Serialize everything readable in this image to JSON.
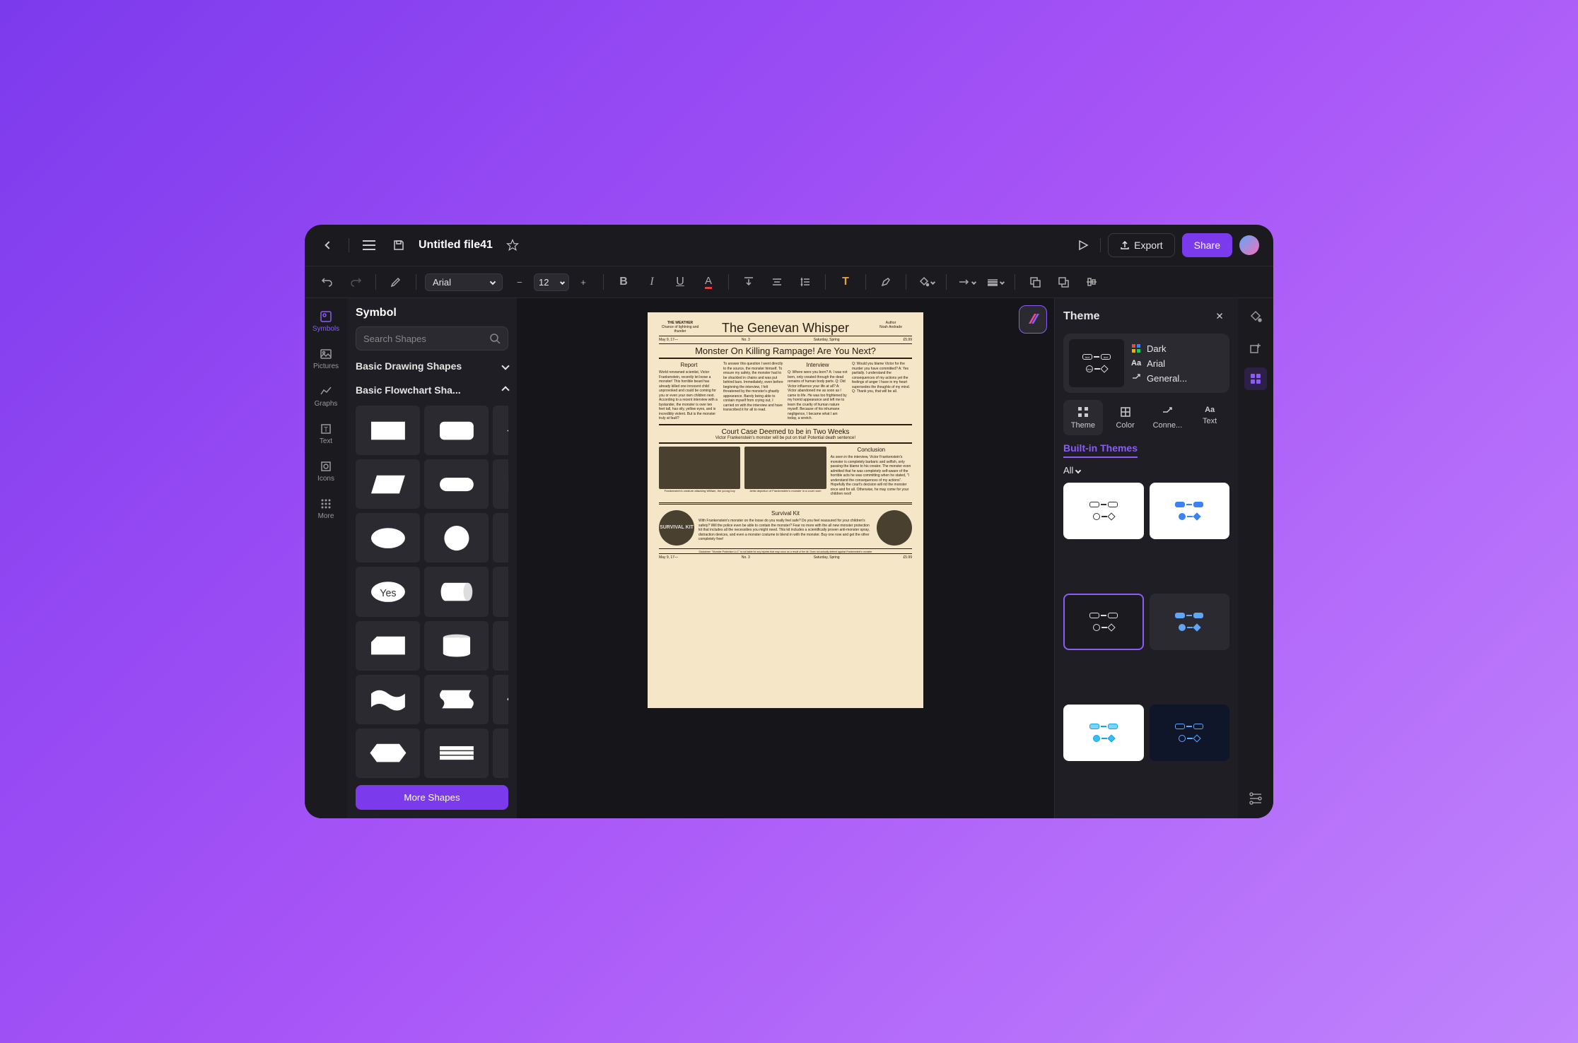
{
  "titlebar": {
    "filename": "Untitled file41",
    "export_label": "Export",
    "share_label": "Share"
  },
  "format_bar": {
    "font": "Arial",
    "size": "12"
  },
  "left_rail": {
    "symbols": "Symbols",
    "pictures": "Pictures",
    "graphs": "Graphs",
    "text": "Text",
    "icons": "Icons",
    "more": "More"
  },
  "left_panel": {
    "title": "Symbol",
    "search_placeholder": "Search Shapes",
    "categories": {
      "basic_drawing": "Basic Drawing Shapes",
      "basic_flowchart": "Basic Flowchart Sha..."
    },
    "decision_label": "Yes",
    "more_shapes": "More Shapes"
  },
  "document": {
    "weather_title": "THE WEATHER",
    "weather_body": "Chance of lightning and thunder",
    "main_title": "The Genevan Whisper",
    "author_label": "Author",
    "author_name": "Noah Andrade",
    "date": "May 9, 17—",
    "issue": "No. 3",
    "day": "Saturday, Spring",
    "price": "£5.99",
    "headline": "Monster On Killing Rampage! Are You Next?",
    "intro": "To answer this question I went directly to the source, the monster",
    "report_title": "Report",
    "report_body": "World renowned scientist, Victor Frankenstein, recently let loose a monster! This horrible beast has already killed one innocent child unprovoked and could be coming for you or even your own children next. According to a recent interview with a bystander, the monster is over ten feet tall, has oily, yellow eyes, and is incredibly violent. But is the monster truly at fault?",
    "col2_body": "himself. To ensure my safety, the monster had to be shackled in chains and was put behind bars. Immediately, even before beginning the interview, I felt threatened by the monster's ghastly appearance. Barely being able to contain myself from crying out, I carried on with the interview and have transcribed it for all to read.",
    "interview_title": "Interview",
    "interview_body": "Q: Where were you born?\nA: I was not born, only created through the dead remains of human body parts.\nQ: Did Victor influence your life at all?\nA: Victor abandoned me as soon as I came to life. He was too frightened by my horrid appearance and left me to learn the cruelty of human nature myself. Because of his inhumane negligence, I became what I am today, a wretch.",
    "col4_body": "Q: Would you blame Victor for the murder you have committed?\nA: Yes partially. I understand the consequences of my actions yet the feelings of anger I have in my heart supersedes the thoughts of my mind.\nQ: Thank you, that will be all.",
    "court_title": "Court Case Deemed to be in Two Weeks",
    "court_sub": "Victor Frankenstein's monster will be put on trial! Potential death sentence!",
    "conclusion_title": "Conclusion",
    "conclusion_body": "As seen in the interview, Victor Frankenstein's monster is completely barbaric and selfish, only passing the blame to his creator. The monster even admitted that he was completely self-aware of the horrible acts he was committing when he stated, \"I understand the consequences of my actions\". Hopefully the court's decision will rid the monster once and for all. Otherwise, he may come for your children next!",
    "caption1": "Frankenstein's creature attacking William, the young boy",
    "caption2": "Artist depiction of Frankenstein's monster in a court room",
    "kit_title": "Survival Kit",
    "kit_body": "With Frankenstein's monster on the loose do you really feel safe? Do you feel reassured for your children's safety? Will the police even be able to contain the monster? Fear no more with the all new monster protection kit that includes all the necessities you might need. This kit includes a scientifically proven anti-monster spray, distraction devices, and even a monster costume to blend in with the monster. Buy one now and get the other completely free!",
    "disclaimer": "Disclaimer: \"Monster Protection LLC\" is not liable for any injuries that may occur as a result of the kit. Does not actually defend against Frankenstein's monster"
  },
  "right_panel": {
    "title": "Theme",
    "current": {
      "color_scheme": "Dark",
      "font": "Arial",
      "connector": "General..."
    },
    "tabs": {
      "theme": "Theme",
      "color": "Color",
      "connector": "Conne...",
      "text": "Text"
    },
    "section": "Built-in Themes",
    "filter": "All"
  }
}
